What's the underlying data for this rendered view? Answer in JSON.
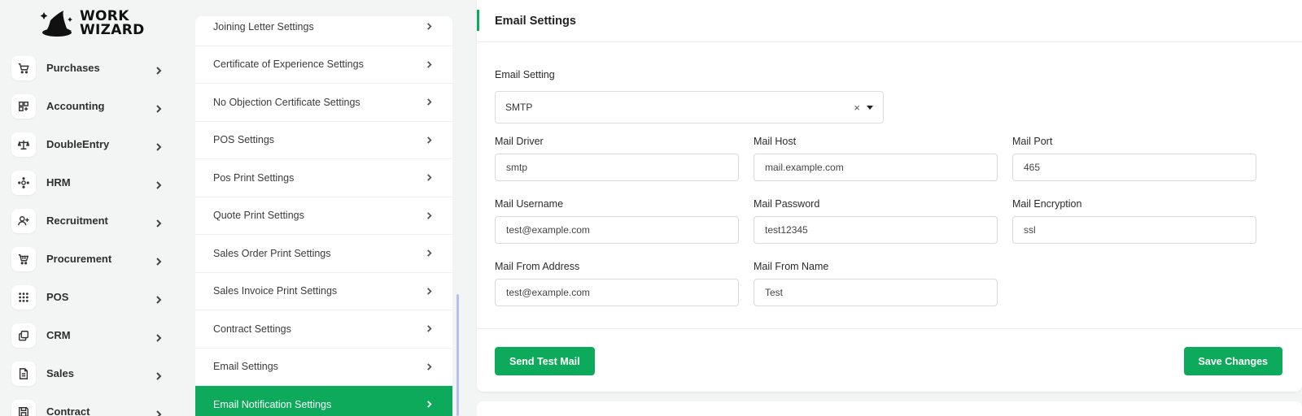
{
  "brand": {
    "line1": "WORK",
    "line2": "WIZARD"
  },
  "sidebar": {
    "items": [
      {
        "label": "Purchases",
        "icon": "cart-icon"
      },
      {
        "label": "Accounting",
        "icon": "grid-plus-icon"
      },
      {
        "label": "DoubleEntry",
        "icon": "scale-icon"
      },
      {
        "label": "HRM",
        "icon": "hub-icon"
      },
      {
        "label": "Recruitment",
        "icon": "user-plus-icon"
      },
      {
        "label": "Procurement",
        "icon": "basket-icon"
      },
      {
        "label": "POS",
        "icon": "dots-grid-icon"
      },
      {
        "label": "CRM",
        "icon": "layers-icon"
      },
      {
        "label": "Sales",
        "icon": "file-icon"
      },
      {
        "label": "Contract",
        "icon": "save-icon"
      }
    ]
  },
  "settings_list": {
    "items": [
      "Joining Letter Settings",
      "Certificate of Experience Settings",
      "No Objection Certificate Settings",
      "POS Settings",
      "Pos Print Settings",
      "Quote Print Settings",
      "Sales Order Print Settings",
      "Sales Invoice Print Settings",
      "Contract Settings",
      "Email Settings",
      "Email Notification Settings"
    ],
    "active_index": 10
  },
  "card": {
    "title": "Email Settings",
    "email_setting": {
      "label": "Email Setting",
      "value": "SMTP",
      "clear": "×"
    },
    "fields": {
      "mail_driver": {
        "label": "Mail Driver",
        "value": "smtp"
      },
      "mail_host": {
        "label": "Mail Host",
        "value": "mail.example.com"
      },
      "mail_port": {
        "label": "Mail Port",
        "value": "465"
      },
      "mail_username": {
        "label": "Mail Username",
        "value": "test@example.com"
      },
      "mail_password": {
        "label": "Mail Password",
        "value": "test12345"
      },
      "mail_encryption": {
        "label": "Mail Encryption",
        "value": "ssl"
      },
      "mail_from_address": {
        "label": "Mail From Address",
        "value": "test@example.com"
      },
      "mail_from_name": {
        "label": "Mail From Name",
        "value": "Test"
      }
    },
    "buttons": {
      "send_test": "Send Test Mail",
      "save": "Save Changes"
    }
  },
  "colors": {
    "accent": "#0caa5a",
    "scroll_thumb": "#b9bdf0"
  }
}
